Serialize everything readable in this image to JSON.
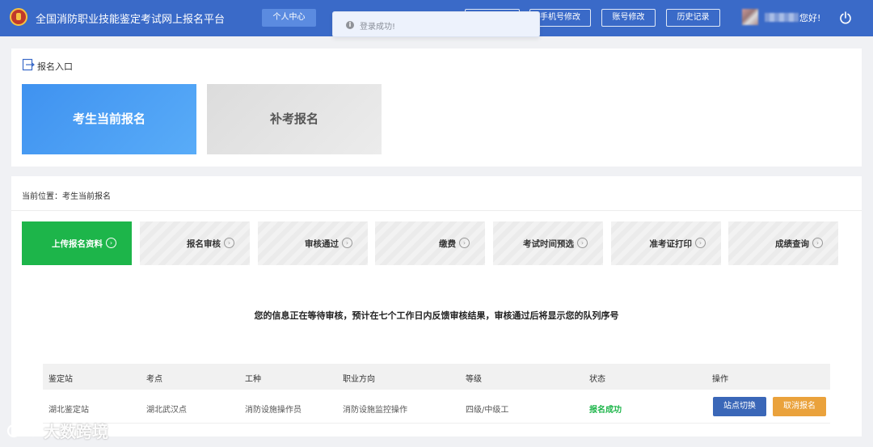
{
  "header": {
    "title": "全国消防职业技能鉴定考试网上报名平台",
    "buttons": [
      "个人中心",
      "",
      "手机号修改",
      "账号修改",
      "历史记录"
    ],
    "greeting": "您好!",
    "brand_color": "#3a6ac8"
  },
  "toast": {
    "text": "登录成功!"
  },
  "entry": {
    "label": "报名入口",
    "cards": {
      "primary": "考生当前报名",
      "secondary": "补考报名"
    }
  },
  "breadcrumb": "当前位置：考生当前报名",
  "steps": [
    {
      "label": "上传报名资料",
      "active": true
    },
    {
      "label": "报名审核",
      "active": false
    },
    {
      "label": "审核通过",
      "active": false
    },
    {
      "label": "缴费",
      "active": false
    },
    {
      "label": "考试时间预选",
      "active": false
    },
    {
      "label": "准考证打印",
      "active": false
    },
    {
      "label": "成绩查询",
      "active": false
    }
  ],
  "notice": "您的信息正在等待审核，预计在七个工作日内反馈审核结果，审核通过后将显示您的队列序号",
  "table": {
    "headers": [
      "鉴定站",
      "考点",
      "工种",
      "职业方向",
      "等级",
      "状态",
      "操作"
    ],
    "row": [
      "湖北鉴定站",
      "湖北武汉点",
      "消防设施操作员",
      "消防设施监控操作",
      "四级/中级工",
      "报名成功"
    ],
    "actions": {
      "switch": "站点切换",
      "cancel": "取消报名"
    }
  },
  "watermark": "大数跨境",
  "colors": {
    "success": "#1db54a",
    "switch_btn": "#3a67b8",
    "cancel_btn": "#eaa23c"
  }
}
